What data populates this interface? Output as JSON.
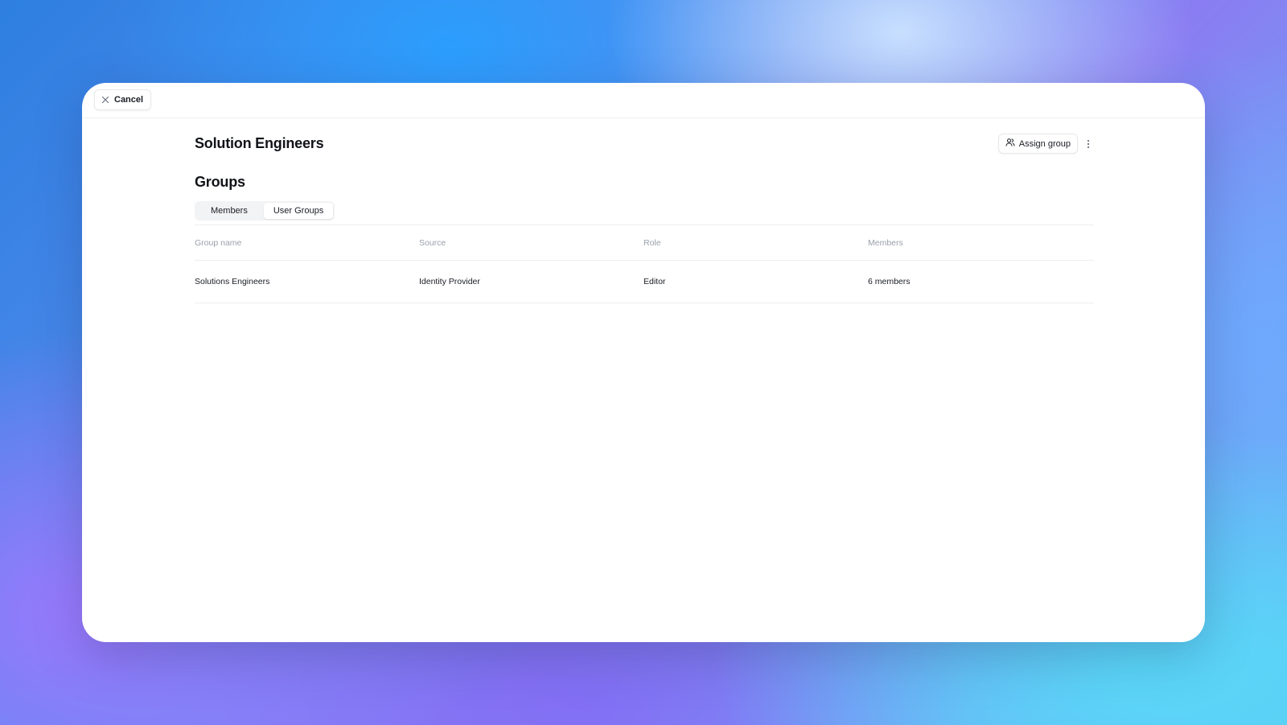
{
  "topbar": {
    "cancel_label": "Cancel",
    "cancel_icon": "close-icon"
  },
  "header": {
    "title": "Solution Engineers",
    "assign_label": "Assign group",
    "assign_icon": "users-icon",
    "more_icon": "more-vertical-icon"
  },
  "section": {
    "title": "Groups"
  },
  "tabs": [
    {
      "label": "Members",
      "active": false
    },
    {
      "label": "User Groups",
      "active": true
    }
  ],
  "table": {
    "columns": [
      "Group name",
      "Source",
      "Role",
      "Members"
    ],
    "rows": [
      [
        "Solutions Engineers",
        "Identity Provider",
        "Editor",
        "6 members"
      ]
    ]
  }
}
